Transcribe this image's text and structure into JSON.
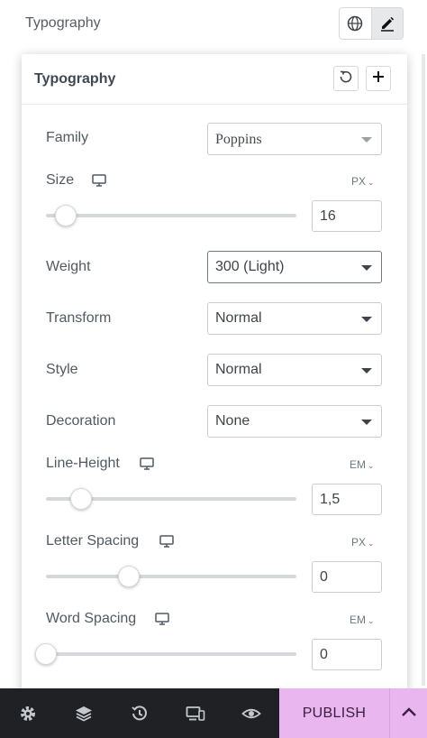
{
  "header": {
    "title": "Typography"
  },
  "panel": {
    "title": "Typography"
  },
  "fields": {
    "family": {
      "label": "Family",
      "value": "Poppins"
    },
    "size": {
      "label": "Size",
      "unit": "PX",
      "value": "16",
      "slider_fraction": 0.08
    },
    "weight": {
      "label": "Weight",
      "value": "300 (Light)"
    },
    "transform": {
      "label": "Transform",
      "value": "Normal"
    },
    "style": {
      "label": "Style",
      "value": "Normal"
    },
    "decoration": {
      "label": "Decoration",
      "value": "None"
    },
    "line_height": {
      "label": "Line-Height",
      "unit": "EM",
      "value": "1,5",
      "slider_fraction": 0.14
    },
    "letter_spacing": {
      "label": "Letter Spacing",
      "unit": "PX",
      "value": "0",
      "slider_fraction": 0.33
    },
    "word_spacing": {
      "label": "Word Spacing",
      "unit": "EM",
      "value": "0",
      "slider_fraction": 0.0
    }
  },
  "footer": {
    "publish_label": "PUBLISH"
  },
  "icons": {
    "globe": "globe-icon",
    "pencil": "pencil-icon",
    "reset": "reset-icon",
    "plus": "plus-icon",
    "desktop": "desktop-icon",
    "settings": "gear-icon",
    "layers": "layers-icon",
    "history": "history-icon",
    "responsive": "responsive-icon",
    "preview": "eye-icon",
    "chevron_up": "chevron-up-icon"
  },
  "colors": {
    "accent": "#e9b6ef",
    "footer_bg": "#1f2124",
    "text": "#515962"
  }
}
